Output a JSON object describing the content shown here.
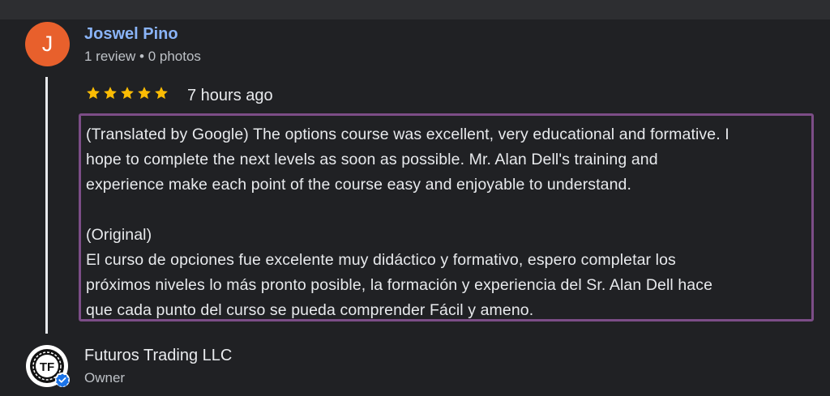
{
  "reviewer": {
    "initial": "J",
    "name": "Joswel Pino",
    "meta": "1 review • 0 photos"
  },
  "review": {
    "rating": 5,
    "time_ago": "7 hours ago",
    "translated_lines": [
      "(Translated by Google) The options course was excellent, very educational and formative. I",
      "hope to complete the next levels as soon as possible. Mr. Alan Dell's training and",
      "experience make each point of the course easy and enjoyable to understand."
    ],
    "original_header": "(Original)",
    "original_lines": [
      "El curso de opciones fue excelente muy didáctico y formativo, espero completar los",
      "próximos niveles lo más pronto posible, la formación y experiencia del Sr. Alan Dell hace",
      "que cada punto del curso se pueda comprender Fácil y ameno."
    ]
  },
  "owner": {
    "logo_text": "TF",
    "name": "Futuros Trading LLC",
    "role": "Owner"
  },
  "colors": {
    "background": "#202124",
    "avatar": "#e8602c",
    "name_link": "#8ab4f8",
    "star": "#fbbc04",
    "highlight_border": "#7c4d87",
    "verified_badge": "#1a73e8"
  }
}
